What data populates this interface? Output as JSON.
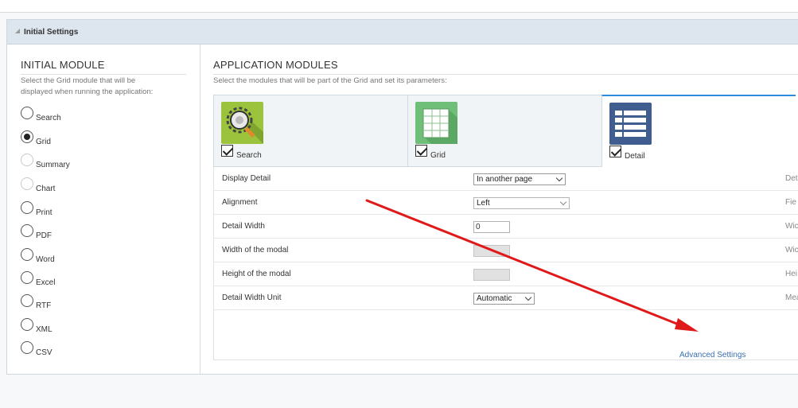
{
  "header": {
    "title": "Initial Settings"
  },
  "initial_module": {
    "title": "INITIAL MODULE",
    "description_line1": "Select the Grid module that will be",
    "description_line2": "displayed when running the application:",
    "options": [
      {
        "label": "Search",
        "state": "unchecked"
      },
      {
        "label": "Grid",
        "state": "checked"
      },
      {
        "label": "Summary",
        "state": "disabled"
      },
      {
        "label": "Chart",
        "state": "disabled"
      },
      {
        "label": "Print",
        "state": "unchecked"
      },
      {
        "label": "PDF",
        "state": "unchecked"
      },
      {
        "label": "Word",
        "state": "unchecked"
      },
      {
        "label": "Excel",
        "state": "unchecked"
      },
      {
        "label": "RTF",
        "state": "unchecked"
      },
      {
        "label": "XML",
        "state": "unchecked"
      },
      {
        "label": "CSV",
        "state": "unchecked"
      }
    ]
  },
  "application_modules": {
    "title": "APPLICATION MODULES",
    "description": "Select the modules that will be part of the Grid and set its parameters:",
    "modules": [
      {
        "label": "Search",
        "checked": true,
        "icon": "magnifier-gear-icon",
        "active": false
      },
      {
        "label": "Grid",
        "checked": true,
        "icon": "table-grid-icon",
        "active": false
      },
      {
        "label": "Detail",
        "checked": true,
        "icon": "detail-list-icon",
        "active": true
      }
    ]
  },
  "properties": [
    {
      "label": "Display Detail",
      "control": "select",
      "value": "In another page",
      "right": "Det"
    },
    {
      "label": "Alignment",
      "control": "select",
      "value": "Left",
      "right": "Fie"
    },
    {
      "label": "Detail Width",
      "control": "input",
      "value": "0",
      "right": "Wic"
    },
    {
      "label": "Width of the modal",
      "control": "input-disabled",
      "value": "",
      "right": "Wic"
    },
    {
      "label": "Height of the modal",
      "control": "input-disabled",
      "value": "",
      "right": "Hei"
    },
    {
      "label": "Detail Width Unit",
      "control": "select",
      "value": "Automatic",
      "right": "Mea"
    }
  ],
  "advanced_settings": "Advanced Settings",
  "colors": {
    "accent": "#2d8ddc",
    "arrow": "#e01a1a",
    "header_bg": "#dde6ef",
    "link": "#3a6fb0"
  }
}
